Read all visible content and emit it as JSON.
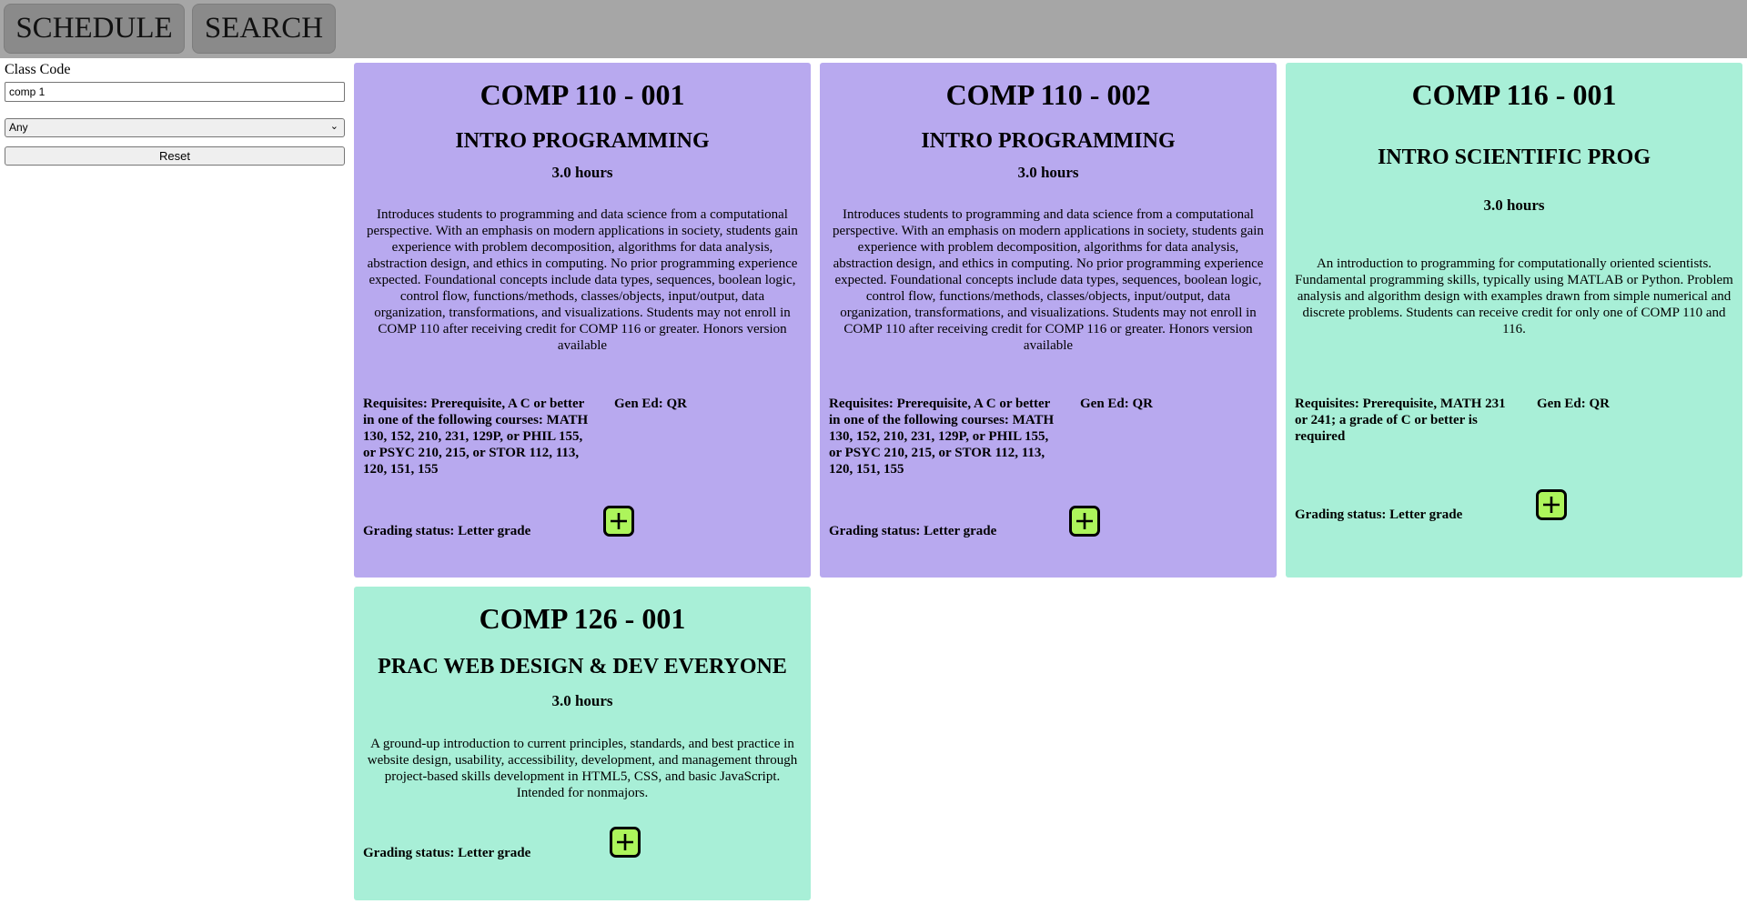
{
  "nav": {
    "schedule": "SCHEDULE",
    "search": "SEARCH"
  },
  "sidebar": {
    "label": "Class Code",
    "input_value": "comp 1",
    "select_value": "Any",
    "reset": "Reset"
  },
  "colors": {
    "purple_card": "#b8a9ef",
    "green_card": "#a8efd7",
    "add_button": "#adf55b",
    "topbar": "#a6a6a6"
  },
  "cards": [
    {
      "code": "COMP 110 - 001",
      "title": "INTRO PROGRAMMING",
      "hours": "3.0 hours",
      "description": "Introduces students to programming and data science from a computational perspective. With an emphasis on modern applications in society, students gain experience with problem decomposition, algorithms for data analysis, abstraction design, and ethics in computing. No prior programming experience expected. Foundational concepts include data types, sequences, boolean logic, control flow, functions/methods, classes/objects, input/output, data organization, transformations, and visualizations. Students may not enroll in COMP 110 after receiving credit for COMP 116 or greater. Honors version available",
      "requisites": "Requisites: Prerequisite, A C or better\nin one of the following courses: MATH\n130, 152, 210, 231, 129P, or PHIL 155,\nor PSYC 210, 215, or STOR 112, 113,\n120, 151, 155",
      "gen_ed": "Gen Ed: QR",
      "grading": "Grading status: Letter grade",
      "add_icon": "plus-icon"
    },
    {
      "code": "COMP 110 - 002",
      "title": "INTRO PROGRAMMING",
      "hours": "3.0 hours",
      "description": "Introduces students to programming and data science from a computational perspective. With an emphasis on modern applications in society, students gain experience with problem decomposition, algorithms for data analysis, abstraction design, and ethics in computing. No prior programming experience expected. Foundational concepts include data types, sequences, boolean logic, control flow, functions/methods, classes/objects, input/output, data organization, transformations, and visualizations. Students may not enroll in COMP 110 after receiving credit for COMP 116 or greater. Honors version available",
      "requisites": "Requisites: Prerequisite, A C or better\nin one of the following courses: MATH\n130, 152, 210, 231, 129P, or PHIL 155,\nor PSYC 210, 215, or STOR 112, 113,\n120, 151, 155",
      "gen_ed": "Gen Ed: QR",
      "grading": "Grading status: Letter grade",
      "add_icon": "plus-icon"
    },
    {
      "code": "COMP 116 - 001",
      "title": "INTRO SCIENTIFIC PROG",
      "hours": "3.0 hours",
      "description": "An introduction to programming for computationally oriented scientists. Fundamental programming skills, typically using MATLAB or Python. Problem analysis and algorithm design with examples drawn from simple numerical and discrete problems. Students can receive credit for only one of COMP 110 and 116.",
      "requisites": "Requisites: Prerequisite, MATH 231\nor 241; a grade of C or better is\nrequired",
      "gen_ed": "Gen Ed: QR",
      "grading": "Grading status: Letter grade",
      "add_icon": "plus-icon"
    },
    {
      "code": "COMP 126 - 001",
      "title": "PRAC WEB DESIGN & DEV EVERYONE",
      "hours": "3.0 hours",
      "description": "A ground-up introduction to current principles, standards, and best practice in website design, usability, accessibility, development, and management through project-based skills development in HTML5, CSS, and basic JavaScript. Intended for nonmajors.",
      "grading": "Grading status: Letter grade",
      "add_icon": "plus-icon"
    }
  ]
}
